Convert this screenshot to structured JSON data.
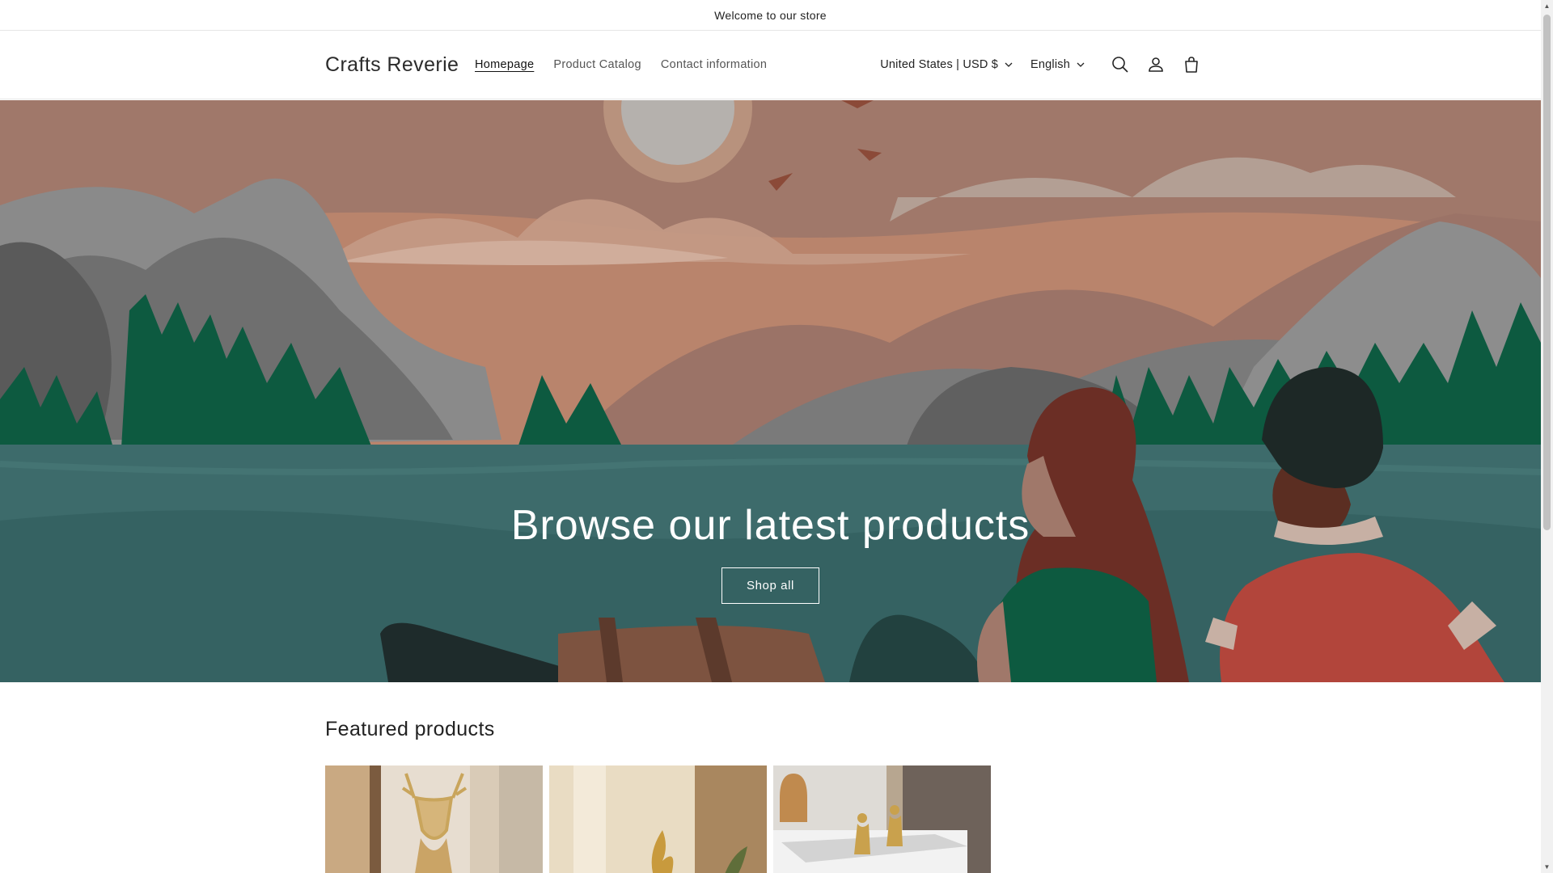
{
  "announcement": {
    "text": "Welcome to our store"
  },
  "header": {
    "logo": "Crafts Reverie",
    "nav": [
      {
        "label": "Homepage",
        "active": true
      },
      {
        "label": "Product Catalog",
        "active": false
      },
      {
        "label": "Contact information",
        "active": false
      }
    ],
    "country_selector": "United States | USD $",
    "language_selector": "English",
    "icons": [
      "search-icon",
      "account-icon",
      "cart-icon"
    ]
  },
  "hero": {
    "title": "Browse our latest products",
    "button_label": "Shop all"
  },
  "featured": {
    "title": "Featured products",
    "products": [
      {
        "image": "gold-deer-head-sculpture"
      },
      {
        "image": "gold-flame-sculpture"
      },
      {
        "image": "gold-thinker-figurines"
      }
    ]
  },
  "colors": {
    "sky": "#b9846c",
    "water": "#3d6b6b",
    "forest": "#0d5a40",
    "mountain": "#6f6f6f",
    "button_border": "#ffffff"
  }
}
